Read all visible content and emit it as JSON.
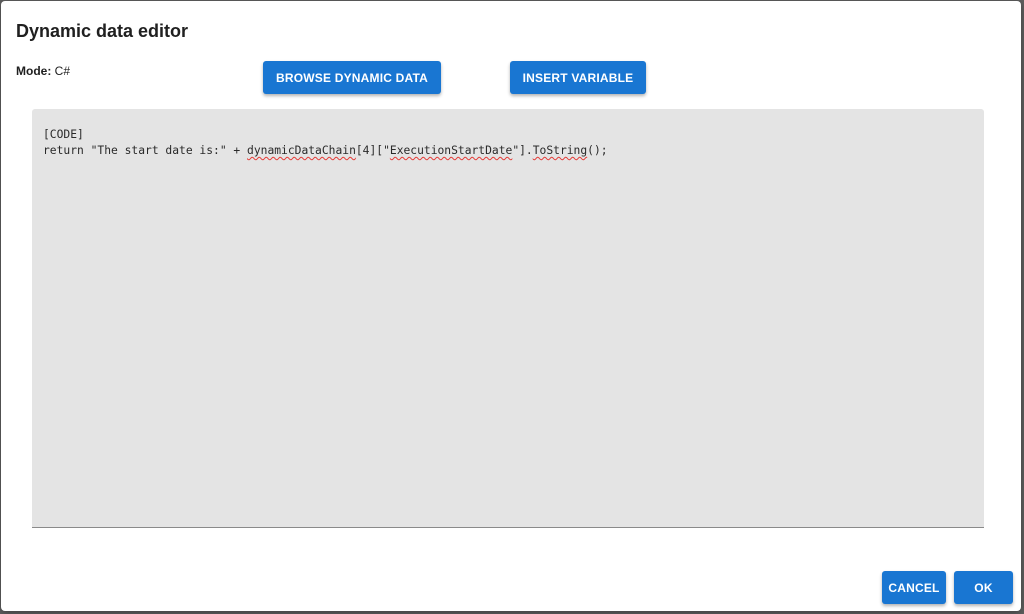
{
  "dialog": {
    "title": "Dynamic data editor",
    "mode_label": "Mode:",
    "mode_value": "C#"
  },
  "toolbar": {
    "browse_label": "BROWSE DYNAMIC DATA",
    "insert_label": "INSERT VARIABLE"
  },
  "editor": {
    "line1": "[CODE]",
    "line2_prefix": "return \"The start date is:\" + ",
    "line2_token1": "dynamicDataChain",
    "line2_mid1": "[4][\"",
    "line2_token2": "ExecutionStartDate",
    "line2_mid2": "\"].",
    "line2_token3": "ToString",
    "line2_suffix": "();"
  },
  "footer": {
    "cancel_label": "CANCEL",
    "ok_label": "OK"
  },
  "colors": {
    "accent": "#1976d2",
    "editor_bg": "#e4e4e4",
    "spell_error": "#e53935"
  }
}
